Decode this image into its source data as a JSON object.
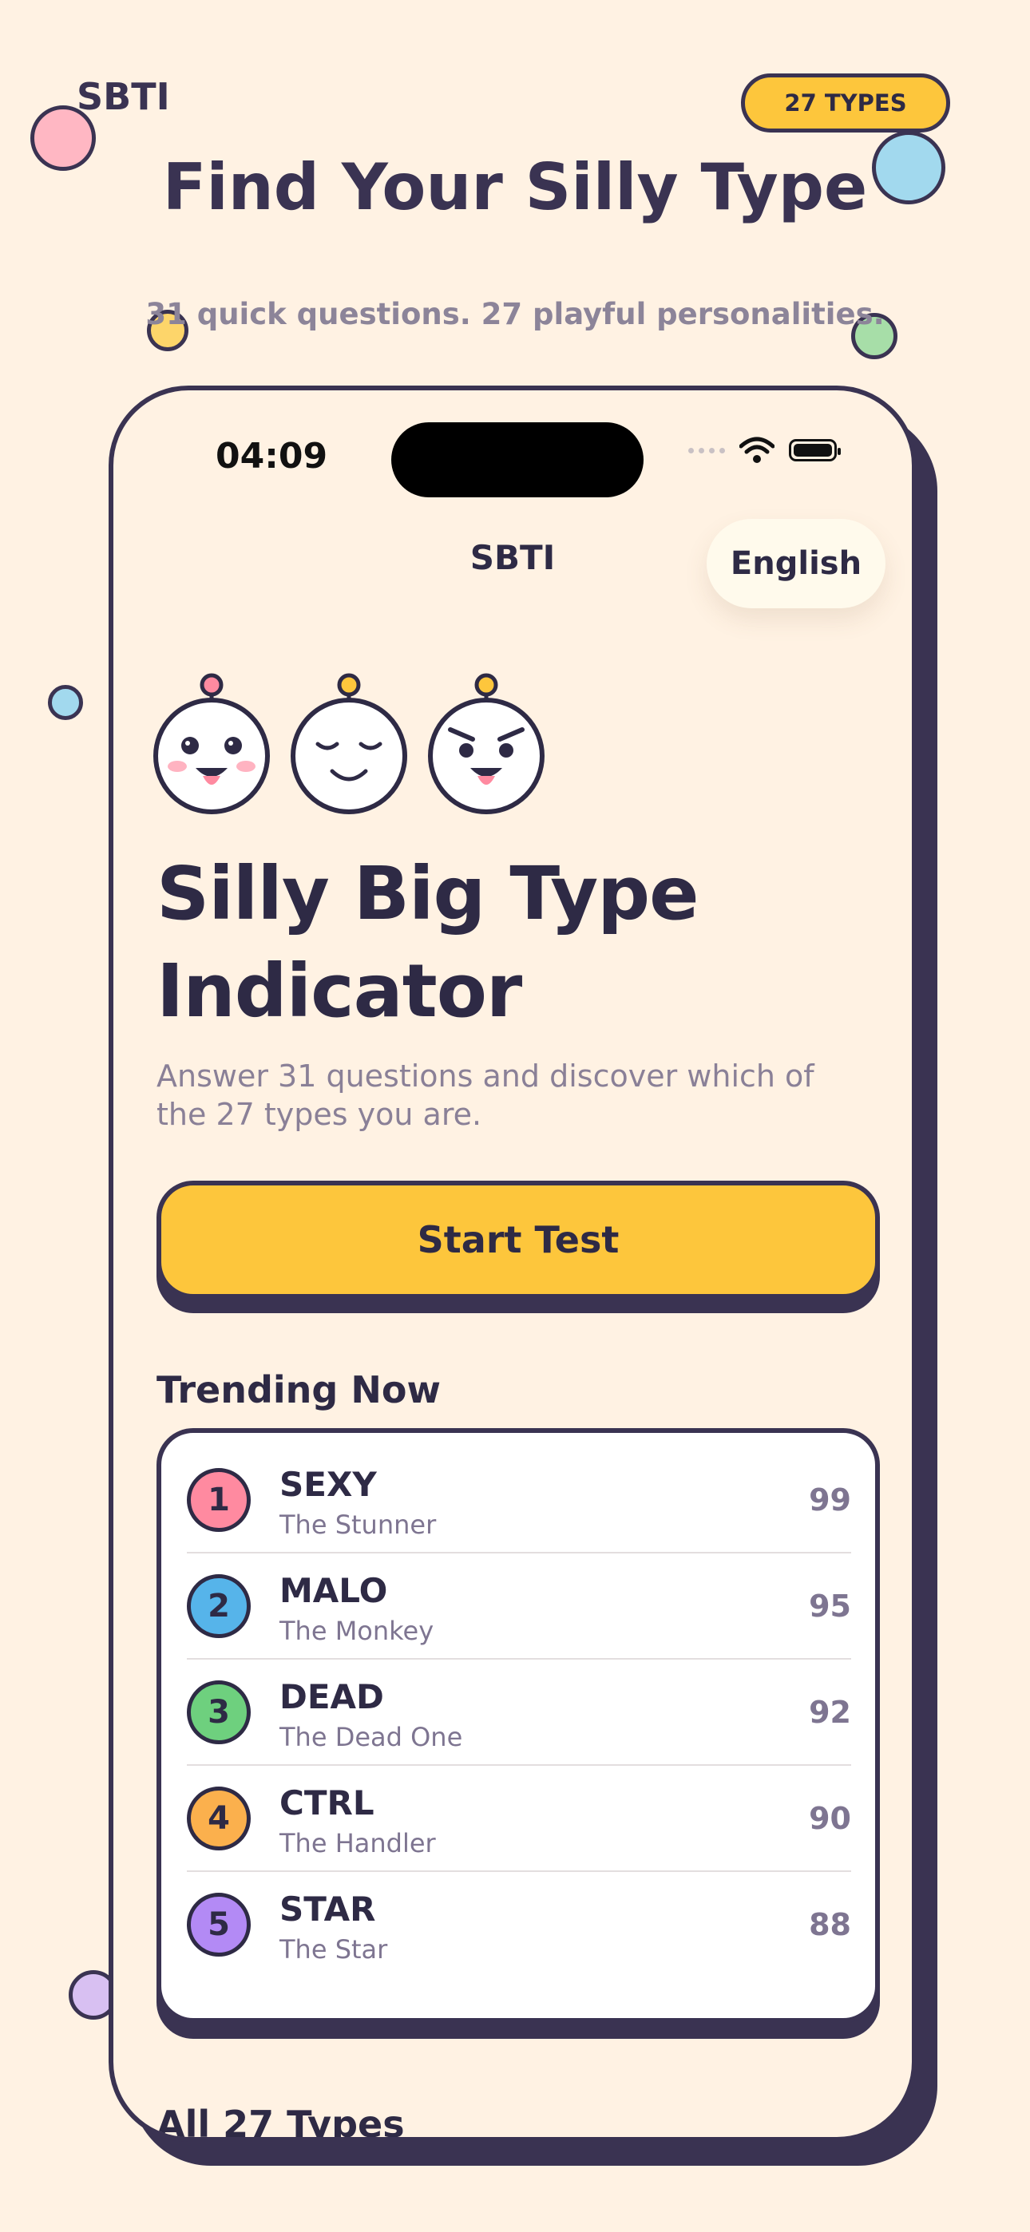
{
  "header": {
    "brand": "SBTI",
    "types_badge": "27 TYPES",
    "title": "Find Your Silly Type",
    "subtitle": "31 quick questions. 27 playful personalities."
  },
  "status_bar": {
    "time": "04:09"
  },
  "app": {
    "title": "SBTI",
    "language_button": "English",
    "hero_title_line1": "Silly Big Type",
    "hero_title_line2": "Indicator",
    "description": "Answer 31 questions and discover which of the 27 types you are.",
    "start_button": "Start Test",
    "trending_heading": "Trending Now",
    "all_types_heading": "All 27 Types"
  },
  "trending": [
    {
      "rank": "1",
      "code": "SEXY",
      "name": "The Stunner",
      "score": "99",
      "color": "#FF8AA0"
    },
    {
      "rank": "2",
      "code": "MALO",
      "name": "The Monkey",
      "score": "95",
      "color": "#56B4EA"
    },
    {
      "rank": "3",
      "code": "DEAD",
      "name": "The Dead One",
      "score": "92",
      "color": "#6ED07E"
    },
    {
      "rank": "4",
      "code": "CTRL",
      "name": "The Handler",
      "score": "90",
      "color": "#FBB04D"
    },
    {
      "rank": "5",
      "code": "STAR",
      "name": "The Star",
      "score": "88",
      "color": "#B38AF5"
    }
  ],
  "colors": {
    "background": "#FFF2E3",
    "accent_yellow": "#FDC63C",
    "outline": "#3A3352"
  }
}
